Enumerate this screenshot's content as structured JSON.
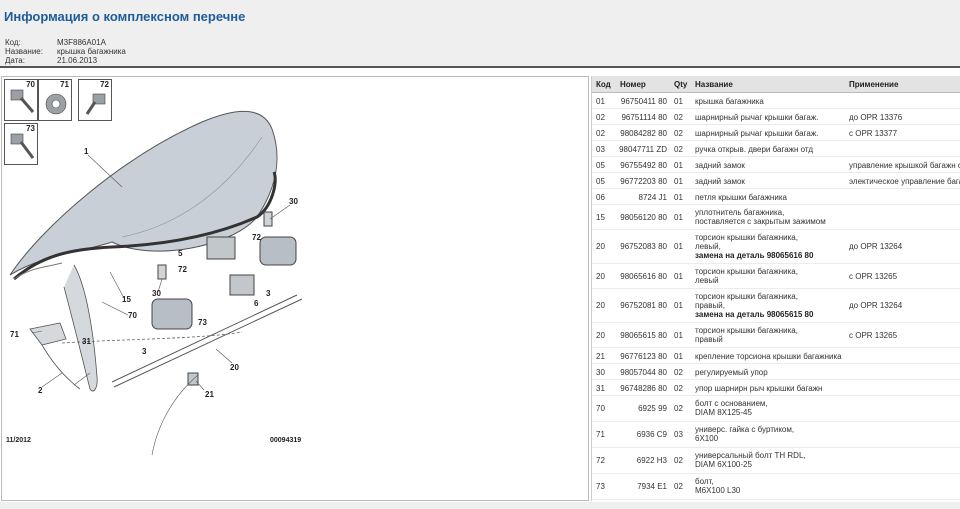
{
  "header": {
    "title": "Информация о комплексном перечне",
    "fields": [
      {
        "key": "Код:",
        "value": "M3F886A01A"
      },
      {
        "key": "Название:",
        "value": "крышка багажника"
      },
      {
        "key": "Дата:",
        "value": "21.06.2013"
      }
    ]
  },
  "diagram": {
    "thumbs": [
      "70",
      "71",
      "72",
      "73"
    ],
    "callouts": [
      "1",
      "30",
      "72",
      "5",
      "72",
      "15",
      "3",
      "6",
      "30",
      "73",
      "70",
      "71",
      "31",
      "3",
      "2",
      "20",
      "21"
    ],
    "footer_left": "11/2012",
    "footer_right": "00094319"
  },
  "table": {
    "headers": {
      "code": "Код",
      "number": "Номер",
      "qty": "Qty",
      "name": "Название",
      "application": "Применение"
    },
    "rows": [
      {
        "code": "01",
        "number": "96750411 80",
        "qty": "01",
        "name": [
          "крышка багажника"
        ],
        "name_bold": "",
        "application": ""
      },
      {
        "code": "02",
        "number": "96751114 80",
        "qty": "02",
        "name": [
          "шарнирный рычаг крышки багаж."
        ],
        "name_bold": "",
        "application": "до OPR 13376"
      },
      {
        "code": "02",
        "number": "98084282 80",
        "qty": "02",
        "name": [
          "шарнирный рычаг крышки багаж."
        ],
        "name_bold": "",
        "application": "с OPR 13377"
      },
      {
        "code": "03",
        "number": "98047711 ZD",
        "qty": "02",
        "name": [
          "ручка открыв. двери багажн отд"
        ],
        "name_bold": "",
        "application": ""
      },
      {
        "code": "05",
        "number": "96755492 80",
        "qty": "01",
        "name": [
          "задний замок"
        ],
        "name_bold": "",
        "application": "управление крышкой багажн с"
      },
      {
        "code": "05",
        "number": "96772203 80",
        "qty": "01",
        "name": [
          "задний замок"
        ],
        "name_bold": "",
        "application": "электическое управление багаж"
      },
      {
        "code": "06",
        "number": "8724 J1",
        "qty": "01",
        "name": [
          "петля крышки багажника"
        ],
        "name_bold": "",
        "application": ""
      },
      {
        "code": "15",
        "number": "98056120 80",
        "qty": "01",
        "name": [
          "уплотнитель багажника,",
          "поставляется с закрытым зажимом"
        ],
        "name_bold": "",
        "application": ""
      },
      {
        "code": "20",
        "number": "96752083 80",
        "qty": "01",
        "name": [
          "торсион крышки багажника,",
          "левый,"
        ],
        "name_bold": "замена на деталь 98065616 80",
        "application": "до OPR 13264"
      },
      {
        "code": "20",
        "number": "98065616 80",
        "qty": "01",
        "name": [
          "торсион крышки багажника,",
          "левый"
        ],
        "name_bold": "",
        "application": "с OPR 13265"
      },
      {
        "code": "20",
        "number": "96752081 80",
        "qty": "01",
        "name": [
          "торсион крышки багажника,",
          "правый,"
        ],
        "name_bold": "замена на деталь 98065615 80",
        "application": "до OPR 13264"
      },
      {
        "code": "20",
        "number": "98065615 80",
        "qty": "01",
        "name": [
          "торсион крышки багажника,",
          "правый"
        ],
        "name_bold": "",
        "application": "с OPR 13265"
      },
      {
        "code": "21",
        "number": "96776123 80",
        "qty": "01",
        "name": [
          "крепление торсиона крышки багажника"
        ],
        "name_bold": "",
        "application": ""
      },
      {
        "code": "30",
        "number": "98057044 80",
        "qty": "02",
        "name": [
          "регулируемый упор"
        ],
        "name_bold": "",
        "application": ""
      },
      {
        "code": "31",
        "number": "96748286 80",
        "qty": "02",
        "name": [
          "упор шарнирн рыч крышки багажн"
        ],
        "name_bold": "",
        "application": ""
      },
      {
        "code": "70",
        "number": "6925 99",
        "qty": "02",
        "name": [
          "болт с основанием,",
          "DIAM 8X125-45"
        ],
        "name_bold": "",
        "application": ""
      },
      {
        "code": "71",
        "number": "6936 C9",
        "qty": "03",
        "name": [
          "универс. гайка с буртиком,",
          "6X100"
        ],
        "name_bold": "",
        "application": ""
      },
      {
        "code": "72",
        "number": "6922 H3",
        "qty": "02",
        "name": [
          "универсальный болт TH RDL,",
          "DIAM 6X100-25"
        ],
        "name_bold": "",
        "application": ""
      },
      {
        "code": "73",
        "number": "7934 E1",
        "qty": "02",
        "name": [
          "болт,",
          "M6X100 L30"
        ],
        "name_bold": "",
        "application": ""
      }
    ]
  }
}
